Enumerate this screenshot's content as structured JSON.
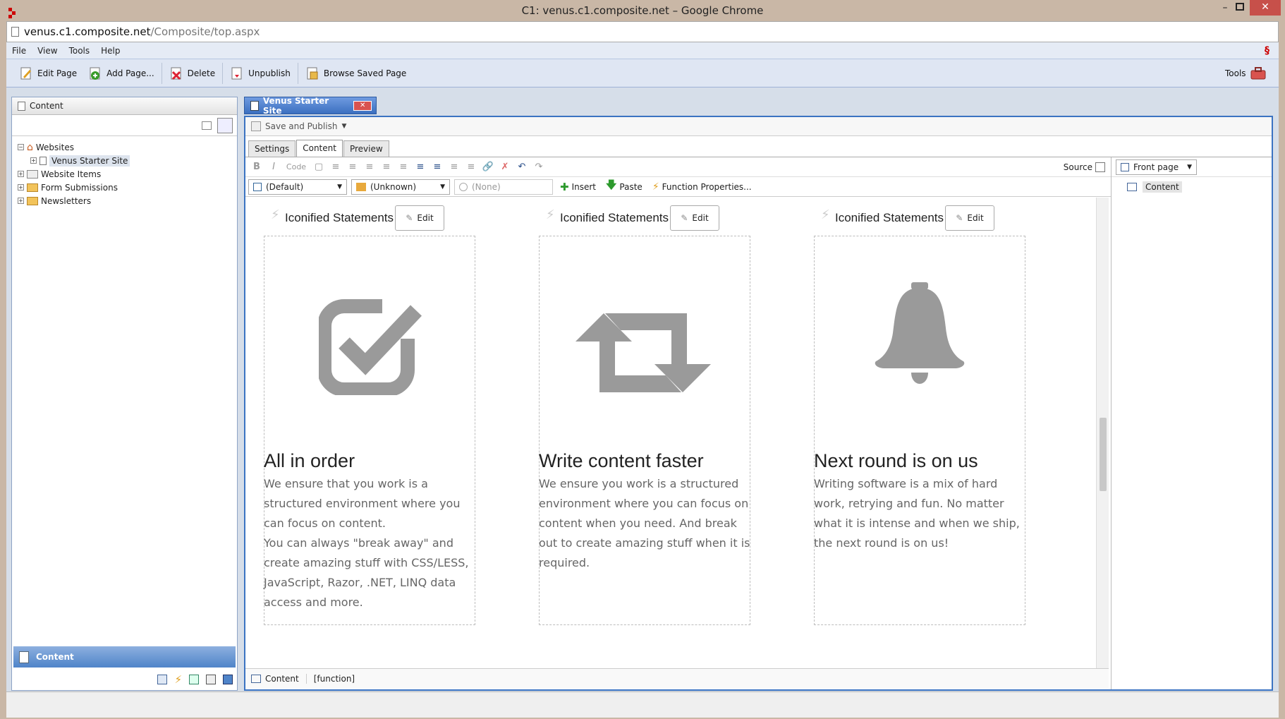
{
  "window": {
    "title": "C1: venus.c1.composite.net – Google Chrome"
  },
  "address": {
    "host": "venus.c1.composite.net",
    "path": "/Composite/top.aspx"
  },
  "menu": {
    "items": [
      "File",
      "View",
      "Tools",
      "Help"
    ]
  },
  "toolbar": {
    "edit_page": "Edit Page",
    "add_page": "Add Page...",
    "delete": "Delete",
    "unpublish": "Unpublish",
    "browse_saved": "Browse Saved Page",
    "tools": "Tools"
  },
  "left": {
    "header": "Content",
    "tree": {
      "websites": "Websites",
      "venus": "Venus Starter Site",
      "website_items": "Website Items",
      "form_submissions": "Form Submissions",
      "newsletters": "Newsletters"
    },
    "footer_selected": "Content"
  },
  "doc": {
    "tab_title": "Venus Starter Site",
    "save_publish": "Save and Publish",
    "tabs": [
      "Settings",
      "Content",
      "Preview"
    ],
    "active_tab": "Content",
    "source_label": "Source",
    "format": {
      "bold": "B",
      "italic": "I",
      "code": "Code"
    },
    "style_select": "(Default)",
    "lang_select": "(Unknown)",
    "class_select": "(None)",
    "insert": "Insert",
    "paste": "Paste",
    "function_props": "Function Properties...",
    "placeholder_select": "Front page",
    "placeholder_item": "Content",
    "bottom_tabs": [
      "Content",
      "[function]"
    ]
  },
  "columns": [
    {
      "label": "Iconified Statements",
      "edit": "Edit",
      "icon": "checkbox-icon",
      "title": "All in order",
      "body": "We ensure that you work is a structured environment where you can focus on content.",
      "body2": "You can always \"break away\" and create amazing stuff with CSS/LESS, JavaScript, Razor, .NET, LINQ data access and more."
    },
    {
      "label": "Iconified Statements",
      "edit": "Edit",
      "icon": "retweet-icon",
      "title": "Write content faster",
      "body": "We ensure you work is a structured environment where you can focus on content when you need. And break out to create amazing stuff when it is required.",
      "body2": ""
    },
    {
      "label": "Iconified Statements",
      "edit": "Edit",
      "icon": "bell-icon",
      "title": "Next round is on us",
      "body": "Writing software is a mix of hard work, retrying and fun. No matter what it is intense and when we ship, the next round is on us!",
      "body2": ""
    }
  ]
}
